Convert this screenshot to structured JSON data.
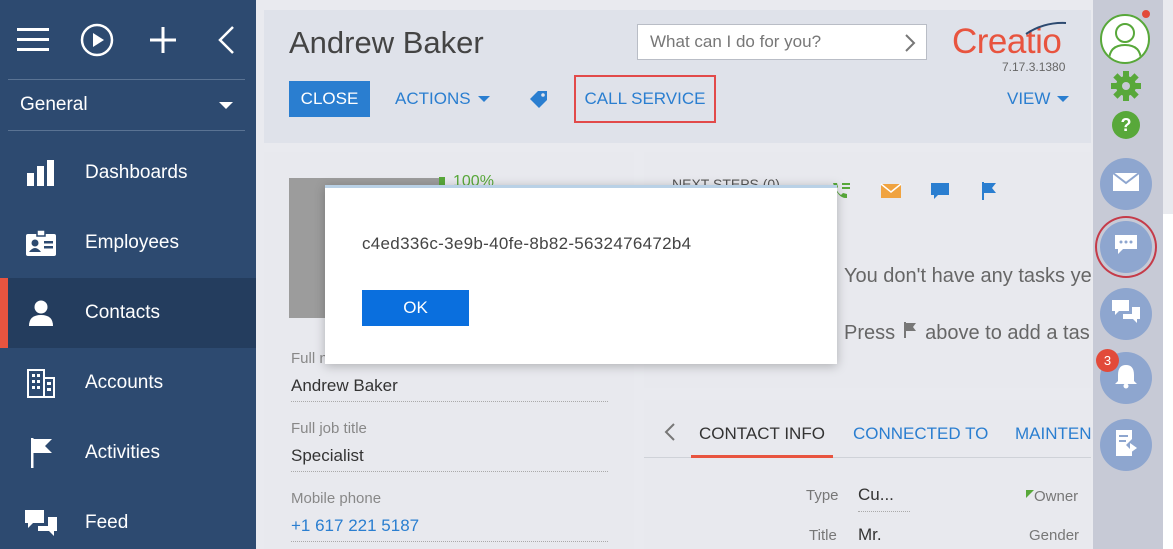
{
  "sidebar": {
    "top_icons": [
      "menu-icon",
      "play-icon",
      "plus-icon",
      "collapse-icon"
    ],
    "workspace": "General",
    "items": [
      {
        "label": "Dashboards",
        "icon": "dashboards-icon"
      },
      {
        "label": "Employees",
        "icon": "employees-icon"
      },
      {
        "label": "Contacts",
        "icon": "contacts-icon",
        "active": true
      },
      {
        "label": "Accounts",
        "icon": "accounts-icon"
      },
      {
        "label": "Activities",
        "icon": "activities-icon"
      },
      {
        "label": "Feed",
        "icon": "feed-icon"
      }
    ]
  },
  "header": {
    "title": "Andrew Baker",
    "search_placeholder": "What can I do for you?",
    "logo": "Creatio",
    "version": "7.17.3.1380",
    "close_label": "CLOSE",
    "actions_label": "ACTIONS",
    "call_service_label": "CALL SERVICE",
    "view_label": "VIEW"
  },
  "profile": {
    "completeness": "100%",
    "fields": [
      {
        "label": "Full name",
        "value": "Andrew Baker"
      },
      {
        "label": "Full job title",
        "value": "Specialist"
      },
      {
        "label": "Mobile phone",
        "value": "+1 617 221 5187"
      }
    ]
  },
  "next_steps": {
    "label": "NEXT STEPS (0)",
    "empty_line1": "You don't have any tasks ye",
    "empty_line2_a": "Press",
    "empty_line2_b": "above to add a tas"
  },
  "tabs": {
    "items": [
      "CONTACT INFO",
      "CONNECTED TO",
      "MAINTENA"
    ],
    "active": 0,
    "info": {
      "type_label": "Type",
      "type_value": "Cu...",
      "owner_label": "Owner",
      "title_label": "Title",
      "title_value": "Mr.",
      "gender_label": "Gender"
    }
  },
  "rightbar": {
    "notification_count": "3",
    "buttons": [
      "email-icon",
      "chat-icon",
      "dialogs-icon",
      "notifications-icon",
      "process-icon"
    ],
    "colors": {
      "setting": "#58a83a",
      "help": "#58a83a",
      "button": "#8ea6cf"
    }
  },
  "modal": {
    "message": "c4ed336c-3e9b-40fe-8b82-5632476472b4",
    "ok_label": "OK"
  },
  "colors": {
    "sidebar_bg": "#2d4a70",
    "accent_blue": "#2a7ed0",
    "accent_red": "#e8543f",
    "highlight_border": "#e24a4a"
  }
}
